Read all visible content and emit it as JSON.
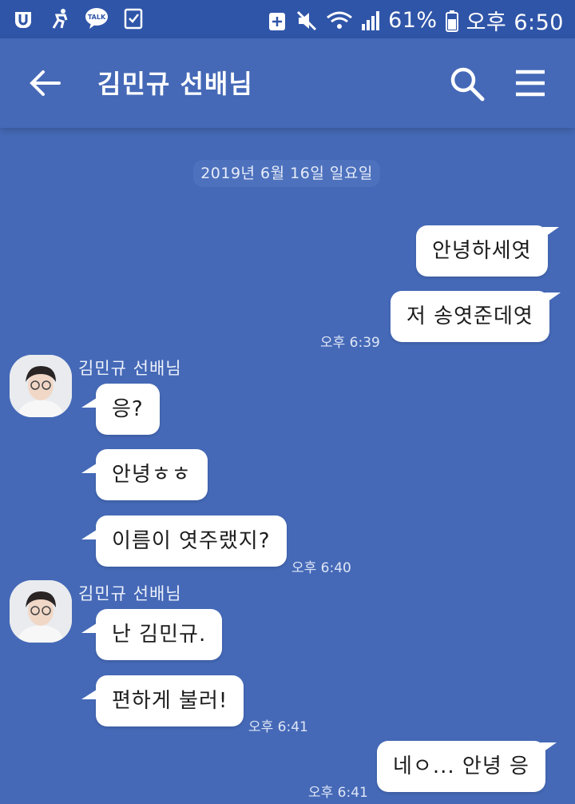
{
  "status_bar": {
    "battery": "61%",
    "time": "오후 6:50",
    "talk_badge": "TALK"
  },
  "header": {
    "title": "김민규 선배님"
  },
  "chat": {
    "date_divider": "2019년 6월 16일 일요일",
    "messages": [
      {
        "side": "right",
        "text": "안녕하세엿"
      },
      {
        "side": "right",
        "text": "저 송엿준데엿",
        "time": "오후 6:39"
      },
      {
        "side": "left",
        "sender": "김민규 선배님",
        "text": "응?"
      },
      {
        "side": "left",
        "text": "안녕ㅎㅎ"
      },
      {
        "side": "left",
        "text": "이름이 엿주랬지?",
        "time": "오후 6:40"
      },
      {
        "side": "left",
        "sender": "김민규 선배님",
        "text": "난 김민규."
      },
      {
        "side": "left",
        "text": "편하게 불러!",
        "time": "오후 6:41"
      },
      {
        "side": "right",
        "text": "네ㅇ... 안녕 응",
        "time": "오후 6:41"
      }
    ]
  },
  "colors": {
    "background": "#4569b7",
    "status_bar": "#2f55a8",
    "bubble": "#ffffff"
  }
}
